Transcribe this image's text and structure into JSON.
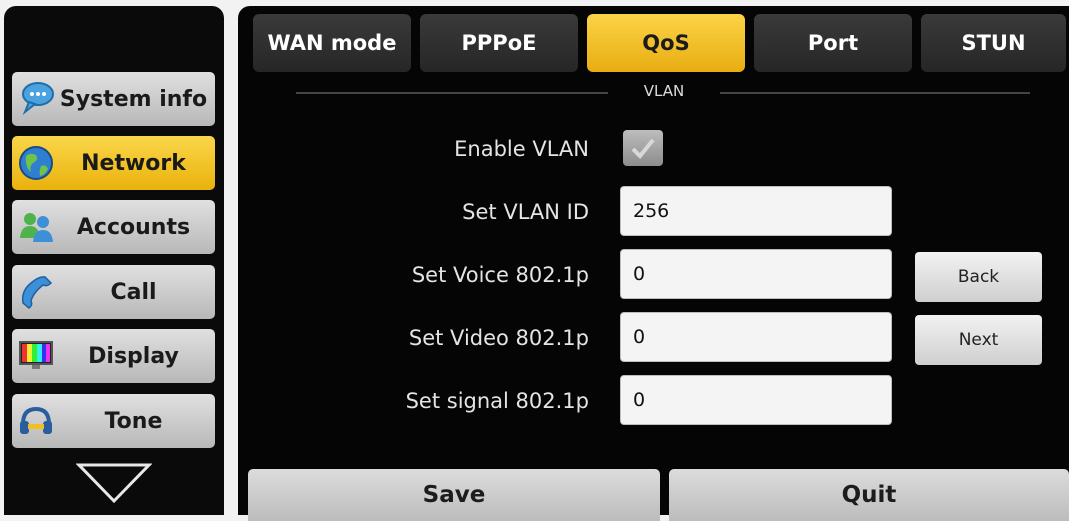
{
  "sidebar": {
    "items": [
      {
        "label": "System info",
        "icon": "chat-bubble-icon",
        "active": false
      },
      {
        "label": "Network",
        "icon": "globe-icon",
        "active": true
      },
      {
        "label": "Accounts",
        "icon": "users-icon",
        "active": false
      },
      {
        "label": "Call",
        "icon": "phone-handset-icon",
        "active": false
      },
      {
        "label": "Display",
        "icon": "color-bars-monitor-icon",
        "active": false
      },
      {
        "label": "Tone",
        "icon": "headset-icon",
        "active": false
      }
    ],
    "more_icon": "chevron-down-icon"
  },
  "tabs": [
    {
      "label": "WAN mode",
      "active": false
    },
    {
      "label": "PPPoE",
      "active": false
    },
    {
      "label": "QoS",
      "active": true
    },
    {
      "label": "Port",
      "active": false
    },
    {
      "label": "STUN",
      "active": false
    }
  ],
  "section": {
    "title": "VLAN"
  },
  "form": {
    "enable_vlan": {
      "label": "Enable VLAN",
      "checked": true
    },
    "vlan_id": {
      "label": "Set VLAN ID",
      "value": "256"
    },
    "voice": {
      "label": "Set Voice 802.1p",
      "value": "0"
    },
    "video": {
      "label": "Set Video 802.1p",
      "value": "0"
    },
    "signal": {
      "label": "Set signal 802.1p",
      "value": "0"
    }
  },
  "buttons": {
    "back": "Back",
    "next": "Next",
    "save": "Save",
    "quit": "Quit"
  },
  "colors": {
    "accent": "#f2c12e",
    "background": "#050505",
    "button": "#d0d0d0"
  }
}
